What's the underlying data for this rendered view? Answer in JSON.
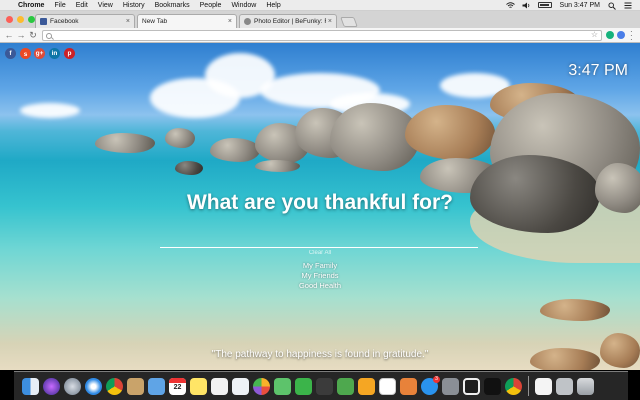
{
  "menubar": {
    "app": "Chrome",
    "items": [
      "File",
      "Edit",
      "View",
      "History",
      "Bookmarks",
      "People",
      "Window",
      "Help"
    ],
    "clock": "Sun 3:47 PM"
  },
  "tabs": [
    {
      "label": "Facebook",
      "favicon_color": "#3b5998"
    },
    {
      "label": "New Tab",
      "favicon_color": ""
    },
    {
      "label": "Photo Editor | BeFunky: Free",
      "favicon_color": "#888888"
    }
  ],
  "omnibox": {
    "value": ""
  },
  "page": {
    "time": "3:47 PM",
    "question": "What are you thankful for?",
    "clear_label": "Clear All",
    "entries": [
      "My Family",
      "My Friends",
      "Good Health"
    ],
    "quote": "\"The pathway to happiness is found in gratitude.\""
  },
  "social": [
    {
      "name": "facebook",
      "glyph": "f"
    },
    {
      "name": "stumbleupon",
      "glyph": "s"
    },
    {
      "name": "google-plus",
      "glyph": "g+"
    },
    {
      "name": "linkedin",
      "glyph": "in"
    },
    {
      "name": "pinterest",
      "glyph": "p"
    }
  ],
  "dock": {
    "calendar_day": "22",
    "appstore_badge": "3"
  },
  "colors": {
    "accent_fb": "#3b5998",
    "accent_gplus": "#dd4b39",
    "accent_linkedin": "#0e76a8",
    "accent_pinterest": "#cb2027"
  }
}
